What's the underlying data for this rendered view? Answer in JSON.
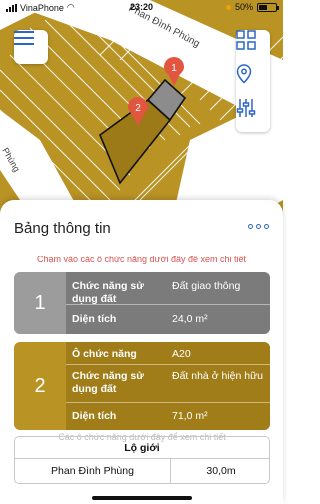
{
  "status_bar": {
    "carrier": "VinaPhone",
    "time": "23:20",
    "battery": "50%"
  },
  "map": {
    "street_top": "Phan Đình Phùng",
    "street_left": "Phùng",
    "markers": [
      "1",
      "2"
    ],
    "colors": {
      "land": "#b99324",
      "selected_1": "#8c8c8c",
      "selected_2": "#9b7a17",
      "outline": "#111111"
    }
  },
  "icons": {
    "menu": "hamburger-menu-icon",
    "layers": "grid-icon",
    "location": "location-pin-icon",
    "filters": "sliders-icon",
    "more": "more-dots-icon"
  },
  "sheet": {
    "title": "Bảng thông tin",
    "hint": "Chạm vào các ô chức năng dưới đây để xem chi tiết"
  },
  "parcels": [
    {
      "number": "1",
      "function_label": "Chức năng sử dụng đất",
      "function_value": "Đất giao thông",
      "area_label": "Diện tích",
      "area_value": "24,0 m²"
    },
    {
      "number": "2",
      "cell_label": "Ô chức năng",
      "cell_value": "A20",
      "function_label": "Chức năng sử dụng đất",
      "function_value": "Đất nhà ở hiện hữu",
      "area_label": "Diện tích",
      "area_value": "71,0 m²"
    }
  ],
  "lo_gioi": {
    "ghost": "Các ô chức năng dưới đây để xem chi tiết",
    "header": "Lộ giới",
    "street": "Phan Đình Phùng",
    "width": "30,0m"
  }
}
